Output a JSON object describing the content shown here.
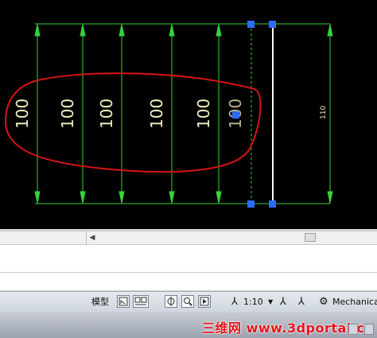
{
  "drawing": {
    "dimensions": [
      "100",
      "100",
      "100",
      "100",
      "100"
    ],
    "overlapped_dimension": "100",
    "right_dimension": "110"
  },
  "statusbar": {
    "model_label": "模型",
    "scale_label": "1:10",
    "workspace_label": "Mechanica"
  },
  "watermark": {
    "text": "三维网 www.3dportal.cn"
  },
  "colors": {
    "background": "#000000",
    "dimension_line": "#39d23c",
    "cloud": "#d81414",
    "grip": "#2d6cff",
    "dimension_text": "#f2f2c0"
  }
}
